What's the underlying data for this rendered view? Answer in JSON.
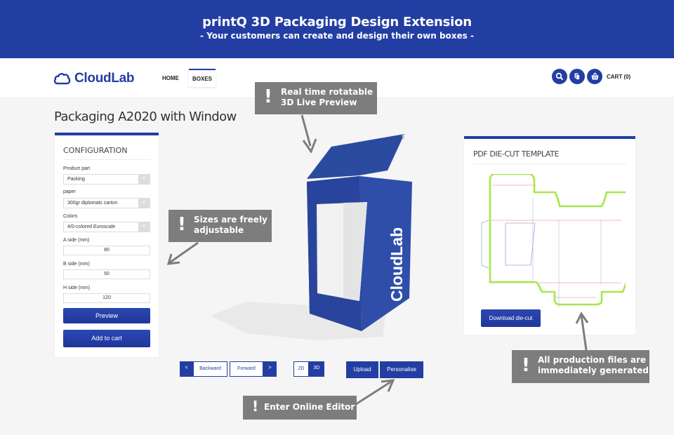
{
  "banner": {
    "title": "printQ 3D Packaging Design Extension",
    "subtitle": "- Your customers can create and design their own boxes -"
  },
  "header": {
    "logo": "CloudLab",
    "nav": [
      {
        "label": "HOME",
        "active": false
      },
      {
        "label": "BOXES",
        "active": true
      }
    ],
    "icons": [
      "search-icon",
      "copy-icon",
      "basket-icon"
    ],
    "cart_label": "CART (0)"
  },
  "page": {
    "title": "Packaging A2020 with Window"
  },
  "configuration": {
    "heading": "CONFIGURATION",
    "product_part": {
      "label": "Product part",
      "value": "Packing"
    },
    "paper": {
      "label": "paper",
      "value": "300gr diplomats carton"
    },
    "colors": {
      "label": "Colors",
      "value": "4/0-colored Euroscale"
    },
    "a_side": {
      "label": "A side (mm)",
      "value": "80"
    },
    "b_side": {
      "label": "B side (mm)",
      "value": "50"
    },
    "h_side": {
      "label": "H side (mm)",
      "value": "120"
    },
    "preview_label": "Preview",
    "add_to_cart_label": "Add to cart"
  },
  "preview": {
    "box_brand": "CloudLab",
    "controls": {
      "backward_arrow": "<",
      "backward_label": "Backward",
      "forward_label": "Forward",
      "forward_arrow": ">",
      "mode_2d": "2D",
      "mode_3d": "3D",
      "active_mode": "3D",
      "upload_label": "Upload",
      "personalise_label": "Personalise"
    }
  },
  "diecut": {
    "heading": "PDF DIE-CUT TEMPLATE",
    "download_label": "Download die-cut"
  },
  "callouts": {
    "exclamation": "!",
    "preview": [
      "Real time rotatable",
      "3D Live Preview"
    ],
    "sizes": [
      "Sizes are freely",
      "adjustable"
    ],
    "editor": [
      "Enter Online Editor"
    ],
    "production": [
      "All production files are",
      "immediately generated"
    ]
  },
  "colors": {
    "brand_blue": "#233ea3",
    "callout_gray": "#7d7d7d",
    "diecut_green": "#a6e84a"
  }
}
